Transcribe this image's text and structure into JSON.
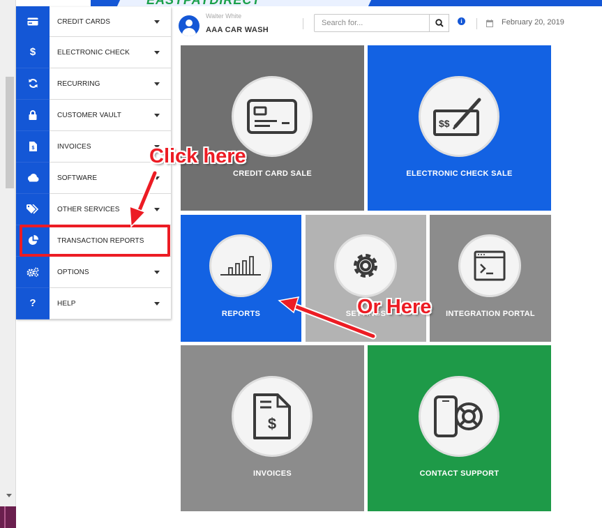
{
  "banner": {
    "logo_text": "EASYPAYDIRECT"
  },
  "sidebar": {
    "items": [
      {
        "label": "CREDIT CARDS",
        "icon": "credit-card-icon",
        "has_caret": true
      },
      {
        "label": "ELECTRONIC CHECK",
        "icon": "dollar-icon",
        "has_caret": true
      },
      {
        "label": "RECURRING",
        "icon": "refresh-icon",
        "has_caret": true
      },
      {
        "label": "CUSTOMER VAULT",
        "icon": "lock-icon",
        "has_caret": true
      },
      {
        "label": "INVOICES",
        "icon": "invoice-file-icon",
        "has_caret": true
      },
      {
        "label": "SOFTWARE",
        "icon": "cloud-icon",
        "has_caret": true
      },
      {
        "label": "OTHER SERVICES",
        "icon": "tags-icon",
        "has_caret": true
      },
      {
        "label": "TRANSACTION REPORTS",
        "icon": "pie-chart-icon",
        "has_caret": false
      },
      {
        "label": "OPTIONS",
        "icon": "cogs-icon",
        "has_caret": true
      },
      {
        "label": "HELP",
        "icon": "question-icon",
        "has_caret": true
      }
    ]
  },
  "header": {
    "user_name": "Walter White",
    "business_name": "AAA CAR WASH",
    "search_placeholder": "Search for...",
    "date": "February 20, 2019"
  },
  "tiles": {
    "credit_card_sale": "CREDIT CARD SALE",
    "electronic_check_sale": "ELECTRONIC CHECK SALE",
    "reports": "REPORTS",
    "settings": "SETTINGS",
    "integration_portal": "INTEGRATION PORTAL",
    "invoices": "INVOICES",
    "contact_support": "CONTACT SUPPORT"
  },
  "annotations": {
    "click_here": "Click here",
    "or_here": "Or Here"
  },
  "colors": {
    "brand_blue": "#1457d6",
    "tile_blue": "#1362e3",
    "tile_green": "#1e9a48",
    "tile_dark_gray": "#707070",
    "tile_gray": "#8c8c8c",
    "tile_light_gray": "#b3b3b3",
    "annotation_red": "#ec1c24"
  }
}
